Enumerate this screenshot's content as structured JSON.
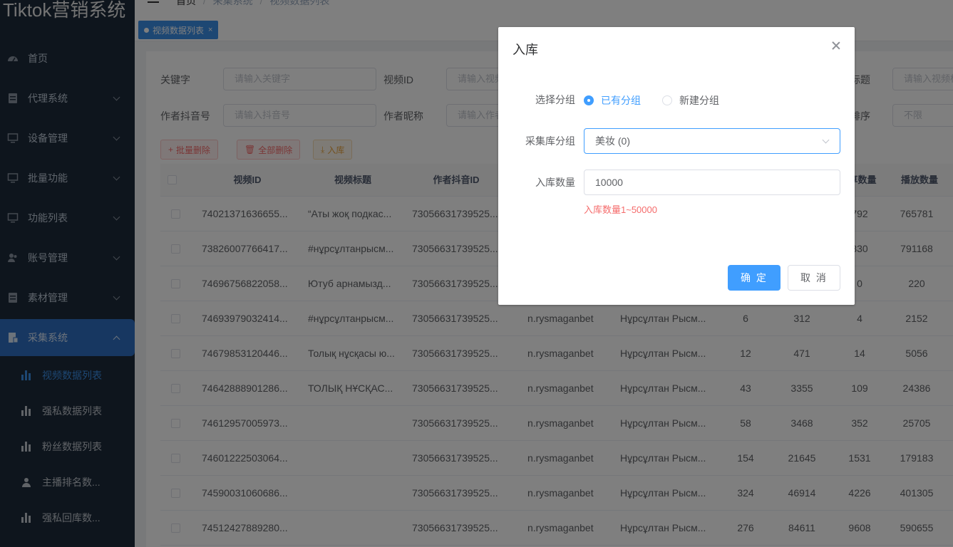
{
  "app": {
    "logo": "Tiktok营销系统"
  },
  "breadcrumb": {
    "home": "首页",
    "sep1": "/",
    "level2": "采集系统",
    "sep2": "/",
    "current": "视频数据列表"
  },
  "sidebar": {
    "items": [
      {
        "label": "首页",
        "icon": "dashboard-icon"
      },
      {
        "label": "代理系统",
        "icon": "document-icon"
      },
      {
        "label": "设备管理",
        "icon": "monitor-icon"
      },
      {
        "label": "批量功能",
        "icon": "monitor-icon"
      },
      {
        "label": "功能列表",
        "icon": "monitor-icon"
      },
      {
        "label": "账号管理",
        "icon": "users-icon"
      },
      {
        "label": "素材管理",
        "icon": "document-icon"
      },
      {
        "label": "采集系统",
        "icon": "collect-icon"
      }
    ],
    "subitems": [
      {
        "label": "视频数据列表",
        "icon": "bar-chart-icon"
      },
      {
        "label": "强私数据列表",
        "icon": "bar-chart-icon"
      },
      {
        "label": "粉丝数据列表",
        "icon": "bar-chart-icon"
      },
      {
        "label": "主播排名数...",
        "icon": "user-icon"
      },
      {
        "label": "强私回库数...",
        "icon": "bar-chart-icon"
      }
    ]
  },
  "tags": {
    "active": "视频数据列表",
    "close": "×"
  },
  "filters": {
    "keyword_label": "关键字",
    "keyword_placeholder": "请输入关键字",
    "videoid_label": "视频ID",
    "videoid_placeholder": "请输入视频",
    "title_label": "标题",
    "title_placeholder": "请输入视频标",
    "author_label": "作者抖音号",
    "author_placeholder": "请输入抖音号",
    "nick_label": "作者昵称",
    "nick_placeholder": "请输入作者",
    "sort_label": "排序",
    "sort_value": "不限"
  },
  "toolbar": {
    "batch_delete": "批量删除",
    "delete_all": "全部删除",
    "import": "入库"
  },
  "table": {
    "headers": [
      "视频ID",
      "视频标题",
      "作者抖音ID",
      "享数量",
      "播放数量"
    ],
    "rows": [
      {
        "id": "74021371636655...",
        "title": "“Аты жоқ подкас...",
        "author_id": "73056631739525...",
        "c1": "",
        "c2": "",
        "c3": "",
        "c4": "792",
        "c5": "765781"
      },
      {
        "id": "73826007766417...",
        "title": "#нұрсұлтанрысм...",
        "author_id": "73056631739525...",
        "c1": "",
        "c2": "",
        "c3": "",
        "c4": "330",
        "c5": "791168"
      },
      {
        "id": "74696756822058...",
        "title": "Ютуб арнамызд...",
        "author_id": "73056631739525...",
        "c1": "",
        "c2": "",
        "c3": "",
        "c4": "0",
        "c5": "220"
      },
      {
        "id": "74693979032414...",
        "title": "#нұрсұлтанрысм...",
        "author_id": "73056631739525...",
        "author": "n.rysmaganbet",
        "nick": "Нұрсұлтан Рысм...",
        "c1": "6",
        "c2": "312",
        "c4": "4",
        "c5": "2152"
      },
      {
        "id": "74679853120446...",
        "title": "Толық нұсқасы ю...",
        "author_id": "73056631739525...",
        "author": "n.rysmaganbet",
        "nick": "Нұрсұлтан Рысм...",
        "c1": "12",
        "c2": "471",
        "c4": "14",
        "c5": "5056"
      },
      {
        "id": "74642888901286...",
        "title": "ТОЛЫҚ НҰСҚАС...",
        "author_id": "73056631739525...",
        "author": "n.rysmaganbet",
        "nick": "Нұрсұлтан Рысм...",
        "c1": "43",
        "c2": "3355",
        "c4": "109",
        "c5": "24386"
      },
      {
        "id": "74612957005973...",
        "title": "",
        "author_id": "73056631739525...",
        "author": "n.rysmaganbet",
        "nick": "Нұрсұлтан Рысм...",
        "c1": "58",
        "c2": "3468",
        "c4": "352",
        "c5": "25705"
      },
      {
        "id": "74601222503064...",
        "title": "",
        "author_id": "73056631739525...",
        "author": "n.rysmaganbet",
        "nick": "Нұрсұлтан Рысм...",
        "c1": "154",
        "c2": "21645",
        "c4": "1531",
        "c5": "179183"
      },
      {
        "id": "74590031060686...",
        "title": "",
        "author_id": "73056631739525...",
        "author": "n.rysmaganbet",
        "nick": "Нұрсұлтан Рысм...",
        "c1": "324",
        "c2": "46914",
        "c4": "4226",
        "c5": "401305"
      },
      {
        "id": "74512427889280...",
        "title": "",
        "author_id": "73056631739525...",
        "author": "n.rysmaganbet",
        "nick": "Нұрсұлтан Рысм...",
        "c1": "276",
        "c2": "84611",
        "c4": "9608",
        "c5": "590655"
      }
    ]
  },
  "dialog": {
    "title": "入库",
    "group_label": "选择分组",
    "radio_existing": "已有分组",
    "radio_new": "新建分组",
    "library_label": "采集库分组",
    "library_value": "美妆 (0)",
    "count_label": "入库数量",
    "count_value": "10000",
    "count_hint": "入库数量1~50000",
    "confirm": "确 定",
    "cancel": "取 消"
  },
  "colors": {
    "primary": "#409eff",
    "sidebar": "#1d2b3a",
    "danger": "#f56c6c"
  }
}
